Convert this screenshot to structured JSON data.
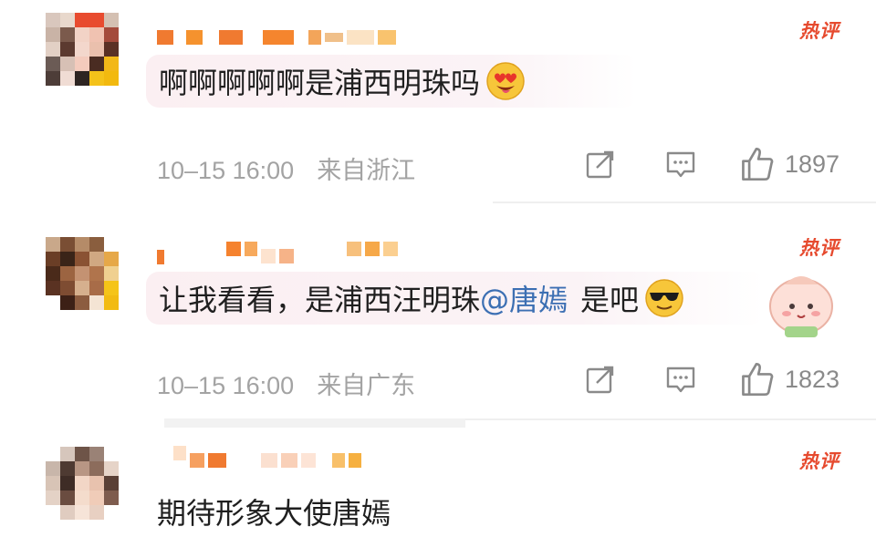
{
  "comments": [
    {
      "badge": "热评",
      "text": "啊啊啊啊啊是浦西明珠吗",
      "emoji": "heart-eyes-emoji",
      "time": "10–15 16:00",
      "location": "来自浙江",
      "likes": "1897"
    },
    {
      "badge": "热评",
      "text_before": "让我看看，是浦西汪明珠",
      "mention": "@唐嫣",
      "text_after": "是吧",
      "emoji": "sunglasses-emoji",
      "time": "10–15 16:00",
      "location": "来自广东",
      "likes": "1823"
    },
    {
      "badge": "热评",
      "text": "期待形象大使唐嫣"
    }
  ],
  "colors": {
    "badge": "#e64a2e",
    "mention": "#3c6fb3",
    "meta": "#a3a3a3",
    "bubble": "#fbeff2"
  },
  "icons": [
    "share-icon",
    "reply-icon",
    "like-icon"
  ]
}
